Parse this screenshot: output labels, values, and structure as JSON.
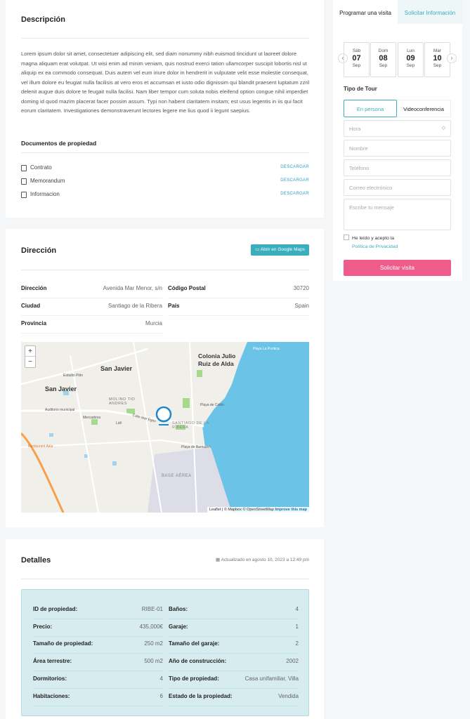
{
  "description": {
    "title": "Descripción",
    "text": "Lorem ipsum dolor sit amet, consectetuer adipiscing elit, sed diam nonummy nibh euismod tincidunt ut laoreet dolore magna aliquam erat volutpat. Ut wisi enim ad minim veniam, quis nostrud exerci tation ullamcorper suscipit lobortis nisl ut aliquip ex ea commodo consequat. Duis autem vel eum iriure dolor in hendrerit in vulputate velit esse molestie consequat, vel illum dolore eu feugiat nulla facilisis at vero eros et accumsan et iusto odio dignissim qui blandit praesent luptatum zzril delenit augue duis dolore te feugait nulla facilisi. Nam liber tempor cum soluta nobis eleifend option congue nihil imperdiet doming id quod mazim placerat facer possim assum. Typi non habent claritatem insitam; est usus legentis in iis qui facit eorum claritatem. Investigationes demonstraverunt lectores legere me lius quod ii legunt saepius.",
    "docs_title": "Documentos de propiedad",
    "docs": [
      {
        "name": "Contrato",
        "action": "DESCARGAR"
      },
      {
        "name": "Memorandum",
        "action": "DESCARGAR"
      },
      {
        "name": "Informacion",
        "action": "DESCARGAR"
      }
    ]
  },
  "address": {
    "title": "Dirección",
    "gmaps_label": "Abrir en Google Maps",
    "rows": [
      {
        "k": "Dirección",
        "v": "Avenida Mar Menor, s/n"
      },
      {
        "k": "Código Postal",
        "v": "30720"
      },
      {
        "k": "Ciudad",
        "v": "Santiago de la Ribera"
      },
      {
        "k": "País",
        "v": "Spain"
      },
      {
        "k": "Provincia",
        "v": "Murcia"
      }
    ],
    "map": {
      "zoom_in": "+",
      "zoom_out": "−",
      "labels": [
        "San Javier",
        "San Javier",
        "Colonia Julio Ruiz de Alda",
        "Estadio Pitín",
        "Auditorio municipal",
        "Mercadona",
        "Lidl",
        "MOLINO TIO ANDRES",
        "Calle Mar Egeo",
        "SANTIAGO DE LA RIBERA",
        "Playa de Colón",
        "Playa de Barnuevo",
        "Restaurant Asia",
        "BASE AÉREA",
        "Playa La Puntica"
      ],
      "attribution": "Leaflet | © Mapbox © OpenStreetMap",
      "improve": "Improve this map"
    }
  },
  "details": {
    "title": "Detalles",
    "updated": "Actualizado en agosto 10, 2023 a 12:49 pm",
    "rows": [
      {
        "k": "ID de propiedad:",
        "v": "RIBE-01"
      },
      {
        "k": "Baños:",
        "v": "4"
      },
      {
        "k": "Precio:",
        "v": "435,000€"
      },
      {
        "k": "Garaje:",
        "v": "1"
      },
      {
        "k": "Tamaño de propiedad:",
        "v": "250 m2"
      },
      {
        "k": "Tamaño del garaje:",
        "v": "2"
      },
      {
        "k": "Área terrestre:",
        "v": "500 m2"
      },
      {
        "k": "Año de construcción:",
        "v": "2002"
      },
      {
        "k": "Dormitorios:",
        "v": "4"
      },
      {
        "k": "Tipo de propiedad:",
        "v": "Casa unifamiliar, Villa"
      },
      {
        "k": "Habitaciones:",
        "v": "6"
      },
      {
        "k": "Estado de la propiedad:",
        "v": "Vendida"
      }
    ]
  },
  "sidebar": {
    "tabs": [
      "Programar una visita",
      "Solicitar Información"
    ],
    "dates": [
      {
        "day": "Sáb",
        "num": "07",
        "month": "Sep"
      },
      {
        "day": "Dom",
        "num": "08",
        "month": "Sep"
      },
      {
        "day": "Lun",
        "num": "09",
        "month": "Sep"
      },
      {
        "day": "Mar",
        "num": "10",
        "month": "Sep"
      }
    ],
    "tour_title": "Tipo de Tour",
    "tour_options": [
      "En persona",
      "Videoconferencia"
    ],
    "placeholders": {
      "hora": "Hora",
      "nombre": "Nombre",
      "telefono": "Teléfono",
      "correo": "Correo electrónico",
      "mensaje": "Escribe tu mensaje"
    },
    "consent": "He leído y acepto la",
    "privacy": "Política de Privacidad",
    "submit": "Solicitar visita"
  },
  "colors": {
    "accent": "#3aaebd",
    "submit": "#ef5b8a",
    "details_bg": "#d6ecef",
    "sea": "#6cc3e8"
  }
}
